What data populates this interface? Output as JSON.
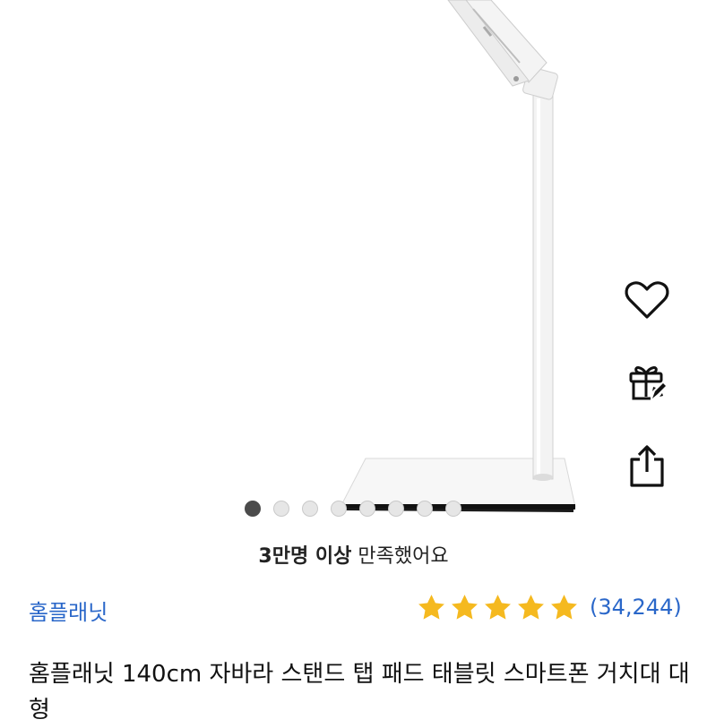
{
  "product_image": {
    "alt_icon": "tablet-stand-image",
    "page_dots_total": 8,
    "page_dot_active_index": 0
  },
  "side_actions": [
    {
      "icon": "heart-icon",
      "name": "wishlist-button"
    },
    {
      "icon": "gift-icon",
      "name": "gift-button"
    },
    {
      "icon": "share-icon",
      "name": "share-button"
    }
  ],
  "satisfaction": {
    "highlight": "3만명 이상",
    "text": " 만족했어요"
  },
  "brand": {
    "name": "홈플래닛",
    "color": "#2a67c9"
  },
  "rating": {
    "stars": 5,
    "review_count": "(34,244)",
    "star_color": "#f5b91f"
  },
  "product": {
    "title": "홈플래닛 140cm 자바라 스탠드 탭 패드 태블릿 스마트폰 거치대 대형"
  }
}
